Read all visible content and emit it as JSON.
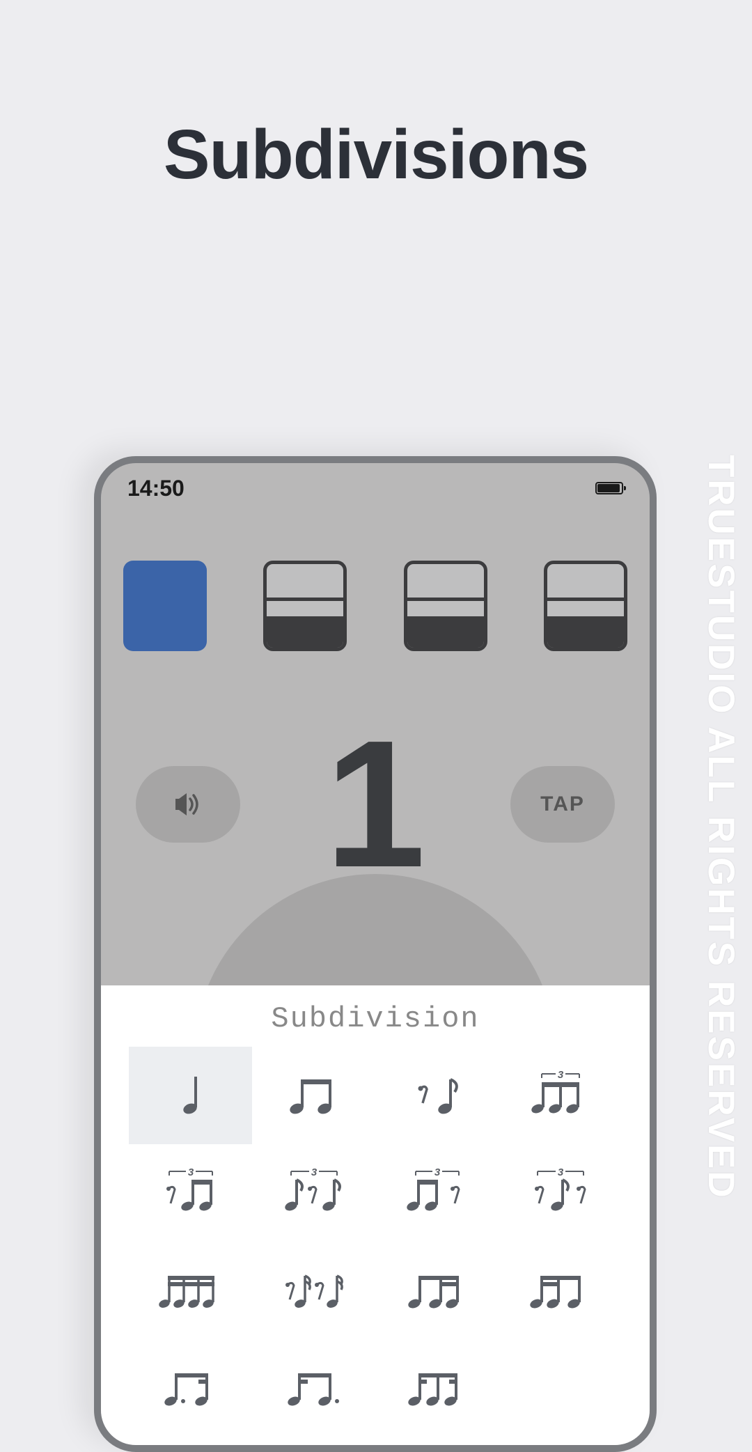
{
  "page_title": "Subdivisions",
  "status": {
    "time": "14:50"
  },
  "beats": {
    "count": 4,
    "active_index": 0,
    "current_number": "1"
  },
  "buttons": {
    "tap_label": "TAP",
    "sound_icon": "speaker-icon"
  },
  "subdivision": {
    "panel_title": "Subdivision",
    "selected_index": 0,
    "options": [
      "quarter",
      "two-eighths",
      "eighth-rest-eighth",
      "triplet",
      "triplet-rest-first",
      "triplet-rest-middle",
      "triplet-rest-last",
      "triplet-rests-outer",
      "four-sixteenths",
      "sixteenth-rest-pattern",
      "eighth-two-sixteenths",
      "two-sixteenths-eighth",
      "dotted-eighth-sixteenth",
      "sixteenth-dotted-eighth",
      "sixteenth-eighth-sixteenth"
    ]
  },
  "watermark": "TRUESTUDIO ALL RIGHTS RESERVED"
}
